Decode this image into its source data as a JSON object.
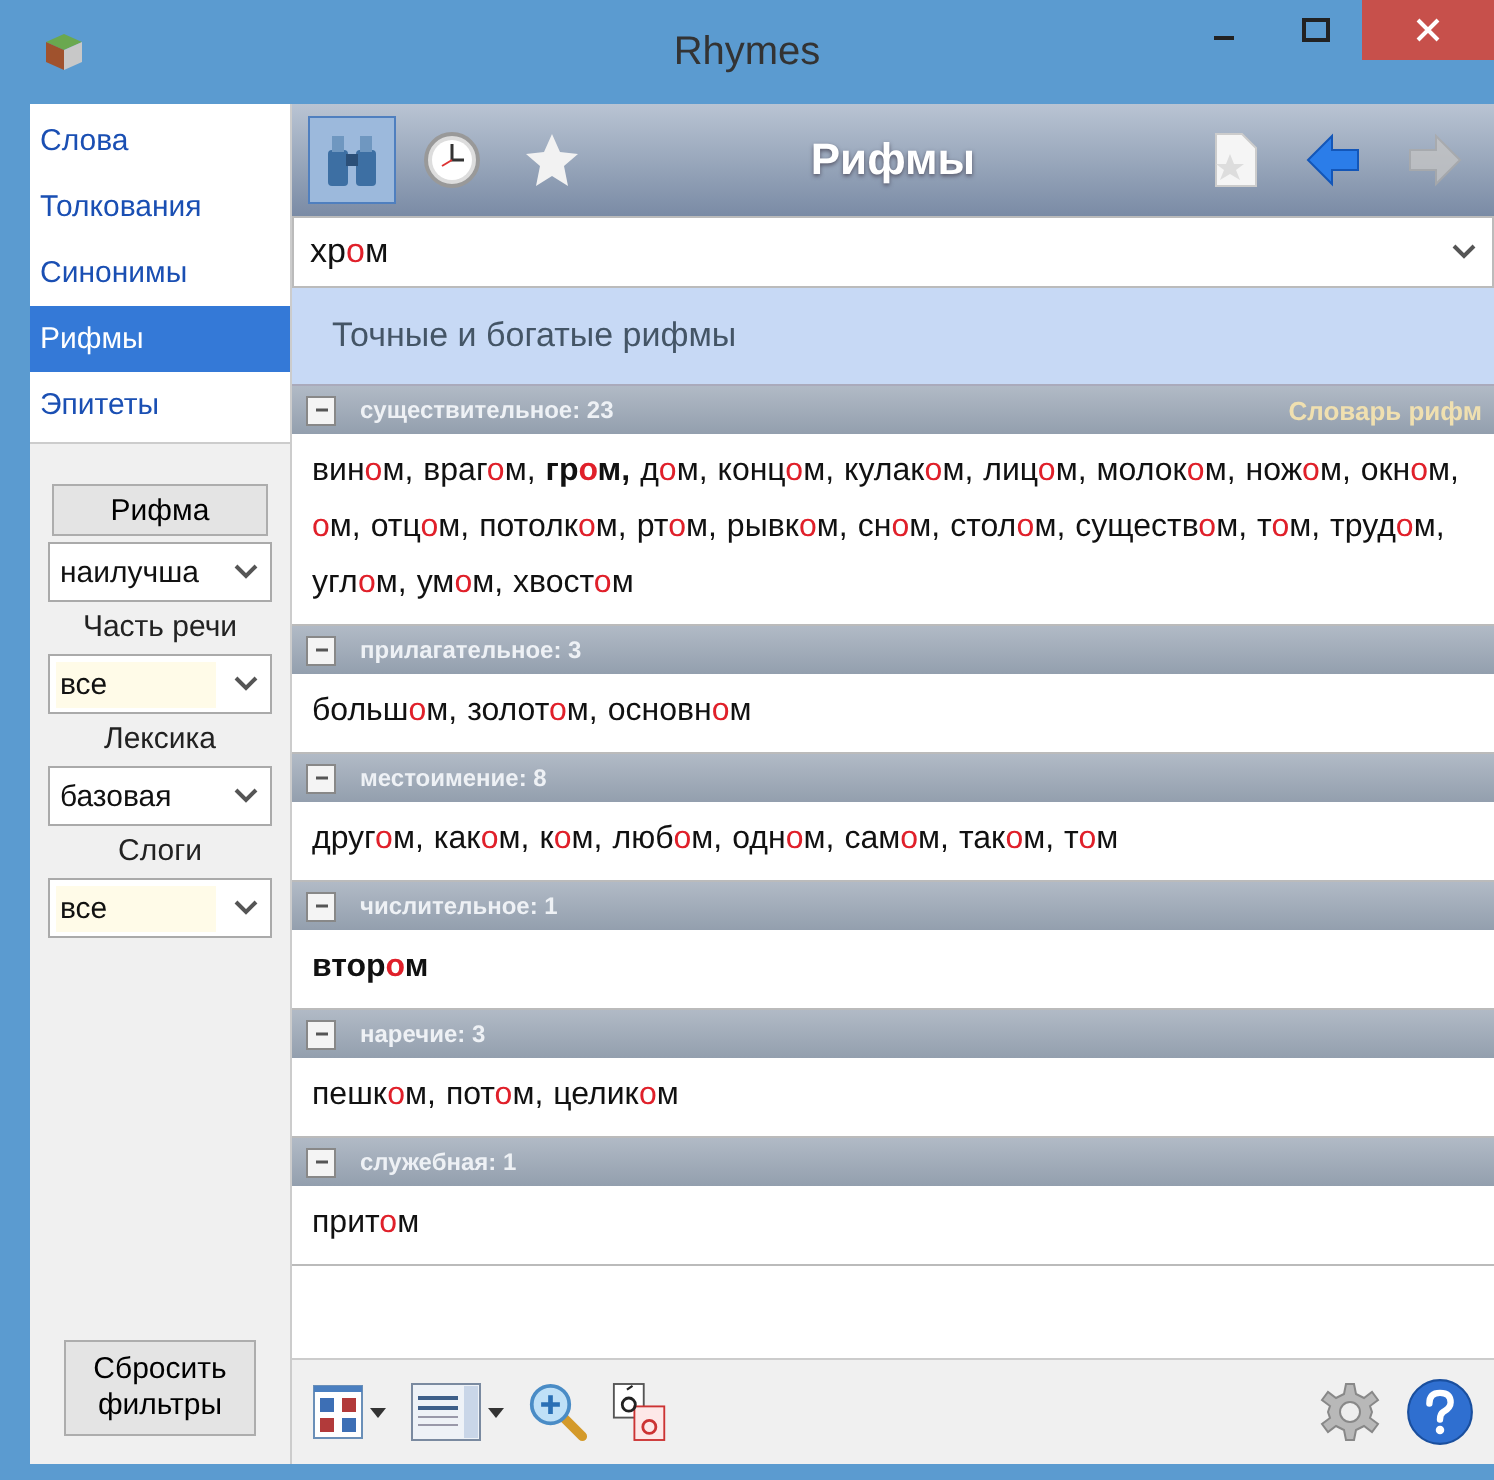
{
  "window": {
    "title": "Rhymes"
  },
  "nav": [
    {
      "label": "Слова",
      "selected": false
    },
    {
      "label": "Толкования",
      "selected": false
    },
    {
      "label": "Синонимы",
      "selected": false
    },
    {
      "label": "Рифмы",
      "selected": true
    },
    {
      "label": "Эпитеты",
      "selected": false
    }
  ],
  "filters": [
    {
      "label": "Рифма",
      "kind": "button",
      "value": "наилучша",
      "highlighted": false
    },
    {
      "label": "Часть речи",
      "kind": "text",
      "value": "все",
      "highlighted": true
    },
    {
      "label": "Лексика",
      "kind": "text",
      "value": "базовая",
      "highlighted": false
    },
    {
      "label": "Слоги",
      "kind": "text",
      "value": "все",
      "highlighted": true
    }
  ],
  "reset_button": "Сбросить фильтры",
  "toolbar": {
    "title": "Рифмы",
    "tools": [
      {
        "kind": "binoculars",
        "selected": true
      },
      {
        "kind": "clock",
        "selected": false
      },
      {
        "kind": "star",
        "selected": false
      }
    ],
    "nav_buttons": [
      {
        "kind": "bookmark",
        "disabled": false
      },
      {
        "kind": "back",
        "disabled": false
      },
      {
        "kind": "forward",
        "disabled": true
      }
    ]
  },
  "search": {
    "before": "хр",
    "stress": "о",
    "after": "м"
  },
  "banner": "Точные и богатые рифмы",
  "sections": [
    {
      "title": "существительное: 23",
      "link": "Словарь рифм",
      "expanded": true,
      "words": [
        {
          "before": "вин",
          "stress": "о",
          "after": "м,",
          "bold": false
        },
        {
          "before": "враг",
          "stress": "о",
          "after": "м,",
          "bold": false
        },
        {
          "before": "гр",
          "stress": "о",
          "after": "м,",
          "bold": true
        },
        {
          "before": "д",
          "stress": "о",
          "after": "м,",
          "bold": false
        },
        {
          "before": "конц",
          "stress": "о",
          "after": "м,",
          "bold": false
        },
        {
          "before": "кулак",
          "stress": "о",
          "after": "м,",
          "bold": false
        },
        {
          "before": "лиц",
          "stress": "о",
          "after": "м,",
          "bold": false
        },
        {
          "before": "молок",
          "stress": "о",
          "after": "м,",
          "bold": false
        },
        {
          "before": "нож",
          "stress": "о",
          "after": "м,",
          "bold": false
        },
        {
          "before": "окн",
          "stress": "о",
          "after": "м,",
          "bold": false
        },
        {
          "stress": "о",
          "after": "м,",
          "bold": false
        },
        {
          "before": "отц",
          "stress": "о",
          "after": "м,",
          "bold": false
        },
        {
          "before": "потолк",
          "stress": "о",
          "after": "м,",
          "bold": false
        },
        {
          "before": "рт",
          "stress": "о",
          "after": "м,",
          "bold": false
        },
        {
          "before": "рывк",
          "stress": "о",
          "after": "м,",
          "bold": false
        },
        {
          "before": "сн",
          "stress": "о",
          "after": "м,",
          "bold": false
        },
        {
          "before": "стол",
          "stress": "о",
          "after": "м,",
          "bold": false
        },
        {
          "before": "существ",
          "stress": "о",
          "after": "м,",
          "bold": false
        },
        {
          "before": "т",
          "stress": "о",
          "after": "м,",
          "bold": false
        },
        {
          "before": "труд",
          "stress": "о",
          "after": "м,",
          "bold": false
        },
        {
          "before": "угл",
          "stress": "о",
          "after": "м,",
          "bold": false
        },
        {
          "before": "ум",
          "stress": "о",
          "after": "м,",
          "bold": false
        },
        {
          "before": "хвост",
          "stress": "о",
          "after": "м",
          "bold": false
        }
      ]
    },
    {
      "title": "прилагательное: 3",
      "expanded": true,
      "words": [
        {
          "before": "больш",
          "stress": "о",
          "after": "м,",
          "bold": false
        },
        {
          "before": "золот",
          "stress": "о",
          "after": "м,",
          "bold": false
        },
        {
          "before": "основн",
          "stress": "о",
          "after": "м",
          "bold": false
        }
      ]
    },
    {
      "title": "местоимение: 8",
      "expanded": true,
      "words": [
        {
          "before": "друг",
          "stress": "о",
          "after": "м,",
          "bold": false
        },
        {
          "before": "как",
          "stress": "о",
          "after": "м,",
          "bold": false
        },
        {
          "before": "к",
          "stress": "о",
          "after": "м,",
          "bold": false
        },
        {
          "before": "люб",
          "stress": "о",
          "after": "м,",
          "bold": false
        },
        {
          "before": "одн",
          "stress": "о",
          "after": "м,",
          "bold": false
        },
        {
          "before": "сам",
          "stress": "о",
          "after": "м,",
          "bold": false
        },
        {
          "before": "так",
          "stress": "о",
          "after": "м,",
          "bold": false
        },
        {
          "before": "т",
          "stress": "о",
          "after": "м",
          "bold": false
        }
      ]
    },
    {
      "title": "числительное: 1",
      "expanded": true,
      "words": [
        {
          "before": "втор",
          "stress": "о",
          "after": "м",
          "bold": true
        }
      ]
    },
    {
      "title": "наречие: 3",
      "expanded": true,
      "words": [
        {
          "before": "пешк",
          "stress": "о",
          "after": "м,",
          "bold": false
        },
        {
          "before": "пот",
          "stress": "о",
          "after": "м,",
          "bold": false
        },
        {
          "before": "целик",
          "stress": "о",
          "after": "м",
          "bold": false
        }
      ]
    },
    {
      "title": "служебная: 1",
      "expanded": true,
      "words": [
        {
          "before": "прит",
          "stress": "о",
          "after": "м",
          "bold": false
        }
      ]
    }
  ]
}
